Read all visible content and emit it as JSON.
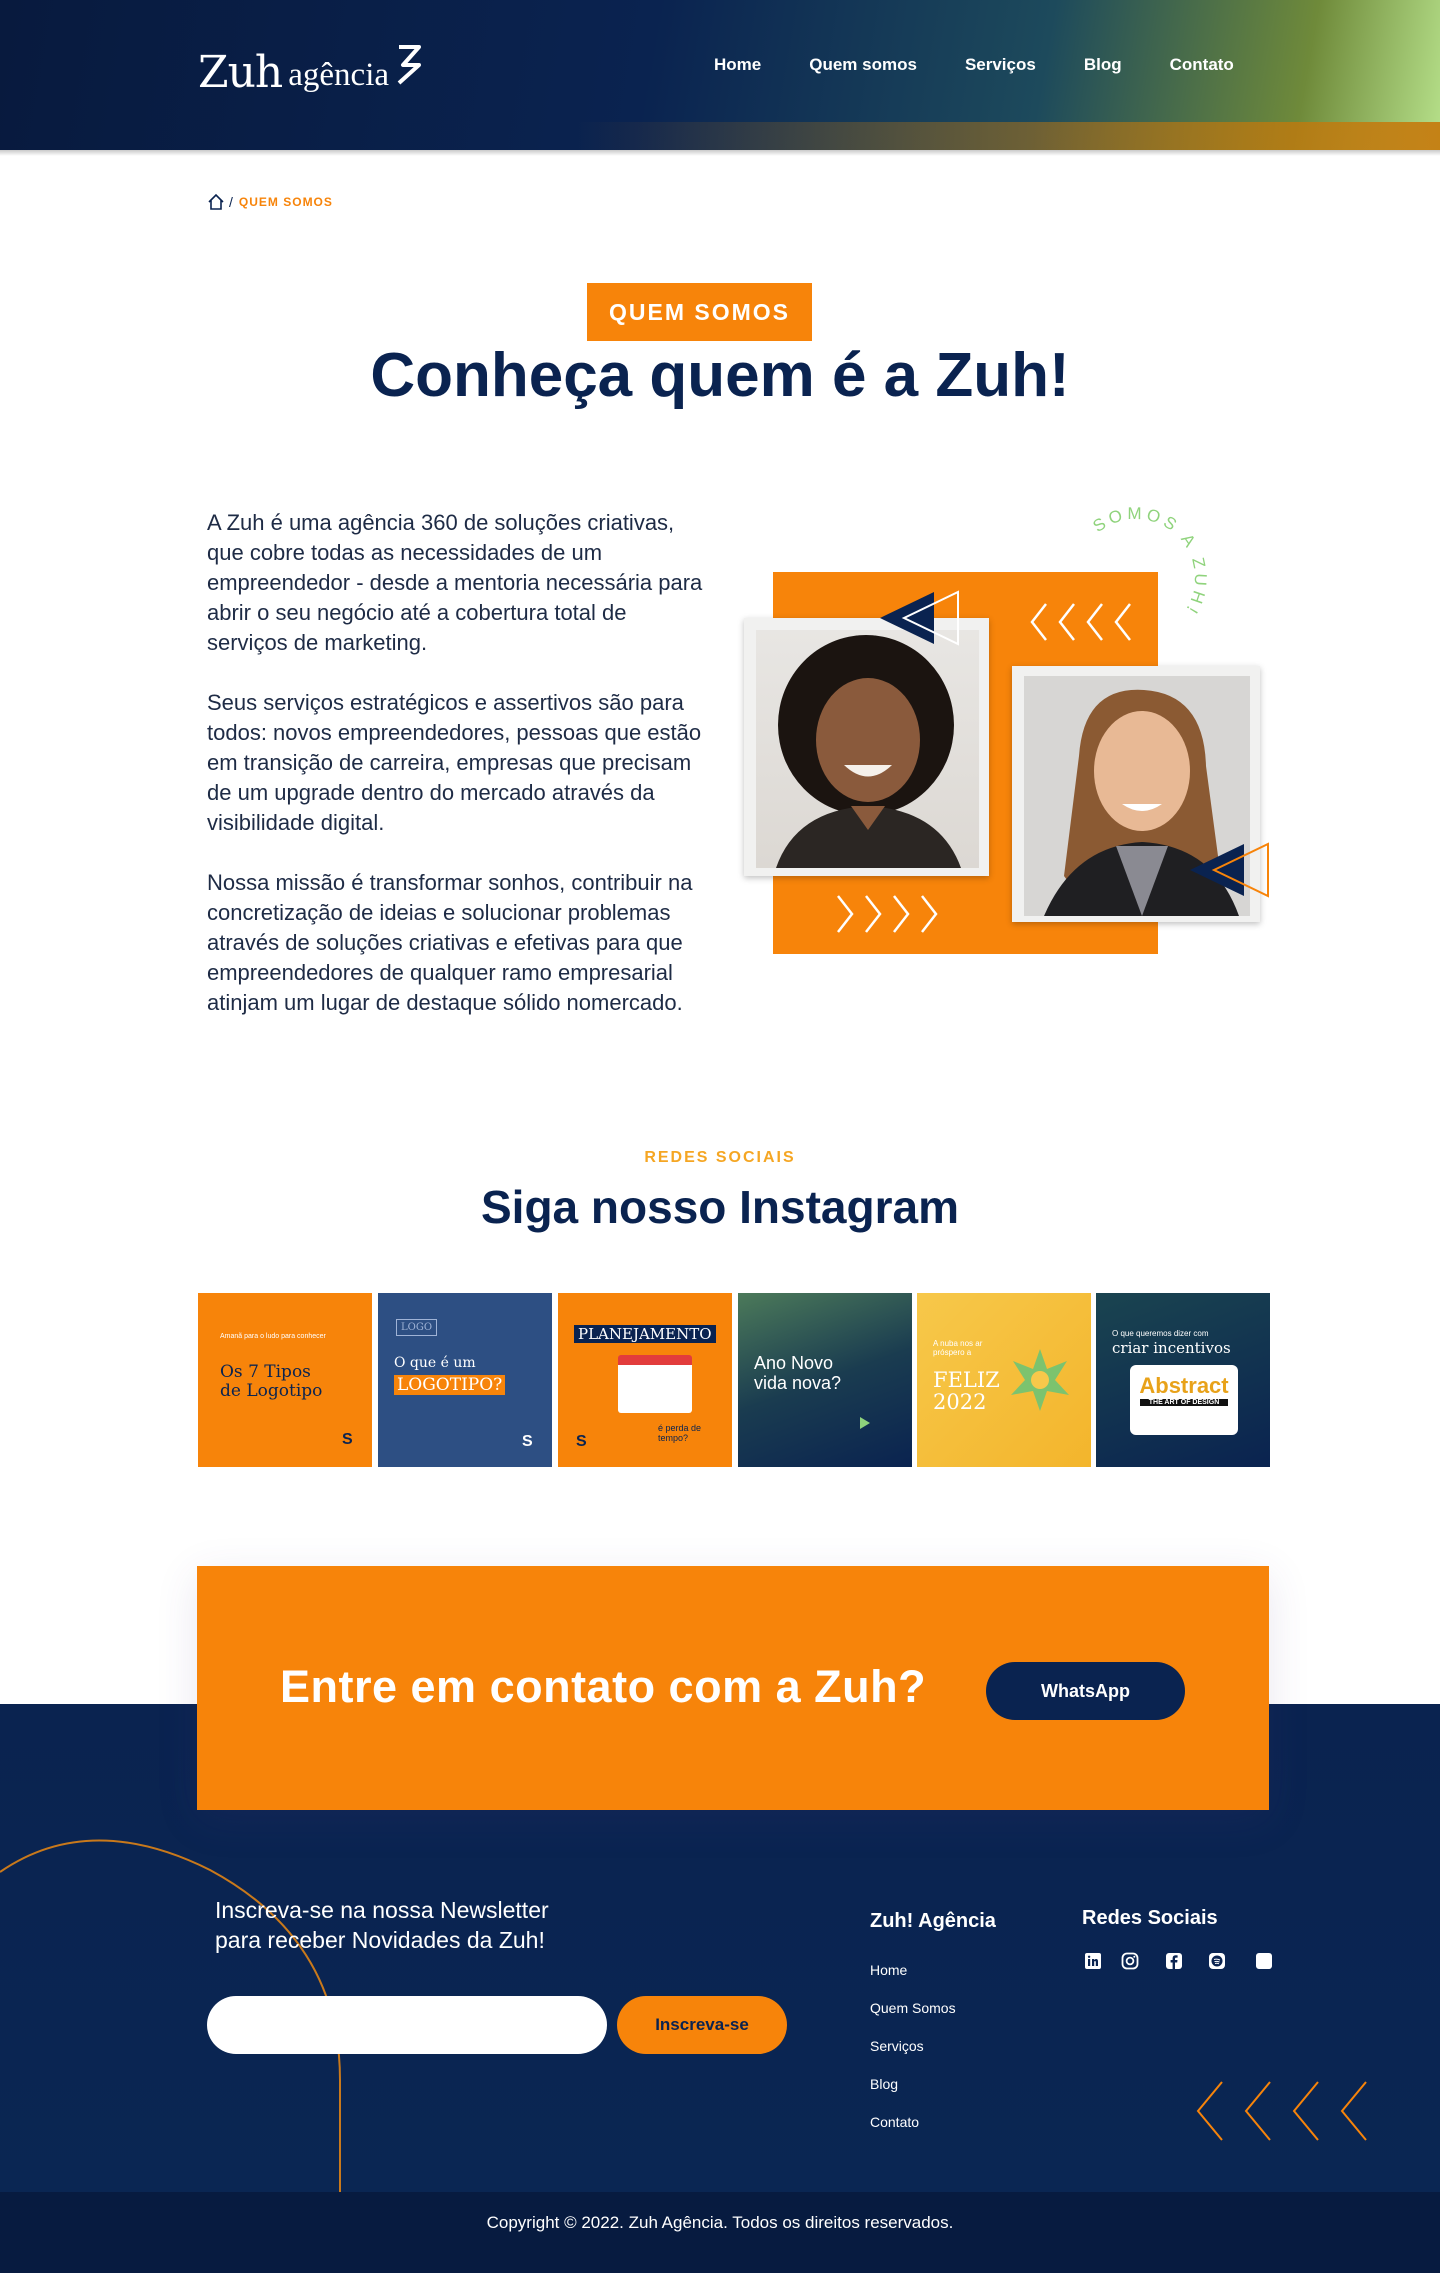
{
  "header": {
    "logo_main": "Zuh",
    "logo_sub": "agência",
    "nav": [
      "Home",
      "Quem somos",
      "Serviços",
      "Blog",
      "Contato"
    ]
  },
  "breadcrumb": {
    "separator": "/",
    "current": "QUEM SOMOS"
  },
  "hero": {
    "badge": "QUEM SOMOS",
    "title": "Conheça quem é a Zuh!"
  },
  "about": {
    "paragraphs": [
      "A Zuh é uma agência 360 de soluções criativas, que cobre todas as necessidades de um empreendedor - desde a mentoria necessária para abrir o seu negócio até a cobertura total de serviços de marketing.",
      "Seus serviços estratégicos e assertivos são para todos: novos empreendedores, pessoas que estão em transição de carreira, empresas que precisam de um upgrade dentro do mercado através da visibilidade digital.",
      "Nossa missão é transformar sonhos, contribuir na concretização de ideias e solucionar problemas através de soluções criativas e efetivas para que empreendedores de qualquer ramo empresarial atinjam um lugar de destaque sólido nomercado."
    ],
    "curved_text": "SOMOS A ZUH!"
  },
  "instagram": {
    "kicker": "REDES SOCIAIS",
    "title": "Siga nosso Instagram",
    "posts": [
      {
        "small": "Amanã para o ludo para conhecer",
        "big": "Os 7 Tipos de Logotipo"
      },
      {
        "small": "LOGO",
        "big": "O que é um",
        "highlight": "LOGOTIPO?"
      },
      {
        "big": "PLANEJAMENTO",
        "small": "é perda de tempo?"
      },
      {
        "big": "Ano Novo vida nova?"
      },
      {
        "small": "A nuba nos ar próspero a",
        "big": "FELIZ 2022"
      },
      {
        "small": "O que queremos dizer com",
        "big": "criar incentivos",
        "highlight": "Abstract",
        "sub": "THE ART OF DESIGN"
      }
    ]
  },
  "cta": {
    "title": "Entre em contato com a Zuh?",
    "button": "WhatsApp"
  },
  "footer": {
    "newsletter_title_1": "Inscreva-se na nossa Newsletter",
    "newsletter_title_2": "para receber Novidades da Zuh!",
    "newsletter_placeholder": "",
    "newsletter_button": "Inscreva-se",
    "col1_title": "Zuh! Agência",
    "links": [
      "Home",
      "Quem Somos",
      "Serviços",
      "Blog",
      "Contato"
    ],
    "col2_title": "Redes Sociais",
    "social_icons": [
      "linkedin-icon",
      "instagram-icon",
      "facebook-icon",
      "spotify-icon",
      "blank-icon"
    ],
    "copyright": "Copyright © 2022. Zuh Agência. Todos os direitos reservados."
  },
  "colors": {
    "navy": "#0a2350",
    "orange": "#f7840a",
    "gold": "#f5a623",
    "green": "#8fd37c"
  }
}
